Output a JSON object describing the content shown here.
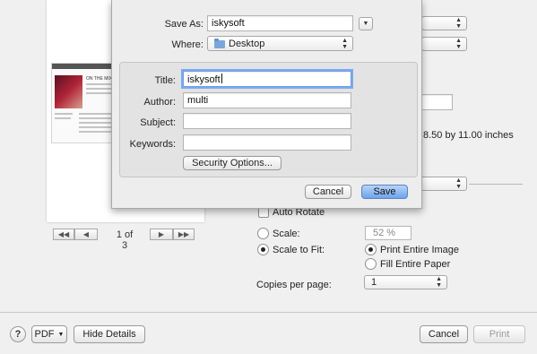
{
  "save_sheet": {
    "save_as_label": "Save As:",
    "save_as_value": "iskysoft",
    "where_label": "Where:",
    "where_value": "Desktop",
    "title_label": "Title:",
    "title_value": "iskysoft",
    "author_label": "Author:",
    "author_value": "multi",
    "subject_label": "Subject:",
    "subject_value": "",
    "keywords_label": "Keywords:",
    "keywords_value": "",
    "security_button": "Security Options...",
    "cancel_button": "Cancel",
    "save_button": "Save"
  },
  "print_dialog": {
    "page_indicator": "1 of 3",
    "paper_size_text": "8.50 by 11.00 inches",
    "auto_rotate_label": "Auto Rotate",
    "scale_label": "Scale:",
    "scale_value": "52 %",
    "scale_to_fit_label": "Scale to Fit:",
    "print_entire_image_label": "Print Entire Image",
    "fill_entire_paper_label": "Fill Entire Paper",
    "copies_per_page_label": "Copies per page:",
    "copies_per_page_value": "1",
    "help_button": "?",
    "pdf_button": "PDF",
    "hide_details_button": "Hide Details",
    "cancel_button": "Cancel",
    "print_button": "Print",
    "preview_thumbnail_title": "ON THE MIX"
  },
  "colors": {
    "default_button": "#6ea4ea",
    "focus_ring": "#7aaaf0",
    "sheet_background": "#ededed"
  }
}
